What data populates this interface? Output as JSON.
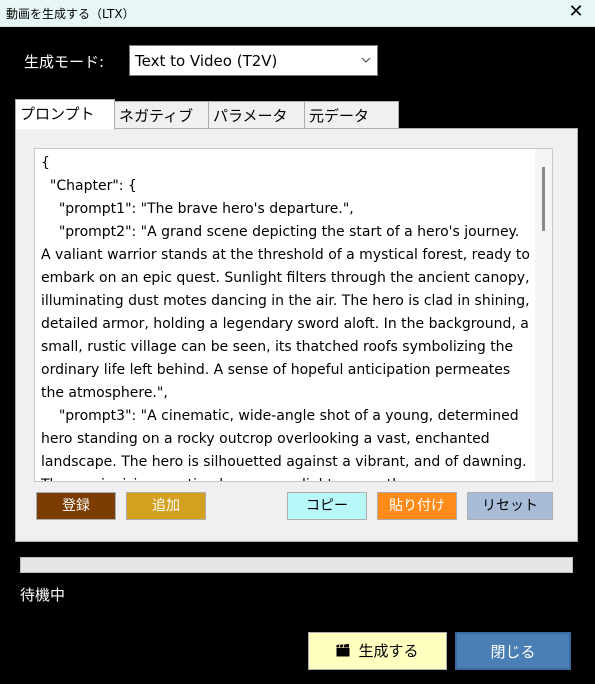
{
  "window": {
    "title": "動画を生成する（LTX）",
    "close_icon": "close-icon"
  },
  "mode": {
    "label": "生成モード:",
    "selected": "Text to Video (T2V)"
  },
  "tabs": [
    {
      "label": "プロンプト",
      "active": true
    },
    {
      "label": "ネガティブ",
      "active": false
    },
    {
      "label": "パラメータ",
      "active": false
    },
    {
      "label": "元データ",
      "active": false
    }
  ],
  "prompt": {
    "text": "{\n  \"Chapter\": {\n    \"prompt1\": \"The brave hero's departure.\",\n    \"prompt2\": \"A grand scene depicting the start of a hero's journey. A valiant warrior stands at the threshold of a mystical forest, ready to embark on an epic quest. Sunlight filters through the ancient canopy, illuminating dust motes dancing in the air. The hero is clad in shining, detailed armor, holding a legendary sword aloft. In the background, a small, rustic village can be seen, its thatched roofs symbolizing the ordinary life left behind. A sense of hopeful anticipation permeates the atmosphere.\",\n    \"prompt3\": \"A cinematic, wide-angle shot of a young, determined hero standing on a rocky outcrop overlooking a vast, enchanted landscape. The hero is silhouetted against a vibrant, and of dawning. The sun is rising, casting long, warm light across the"
  },
  "buttons": {
    "register": "登録",
    "add": "追加",
    "copy": "コピー",
    "paste": "貼り付け",
    "reset": "リセット",
    "generate": "生成する",
    "close": "閉じる"
  },
  "progress": {
    "value": 0
  },
  "status": "待機中",
  "colors": {
    "register_bg": "#7a3c00",
    "add_bg": "#d4a020",
    "copy_bg": "#b8f8f8",
    "paste_bg": "#ff8c1a",
    "reset_bg": "#a8bcd8",
    "generate_bg": "#ffffc0",
    "close_bg": "#4a7fb5"
  }
}
